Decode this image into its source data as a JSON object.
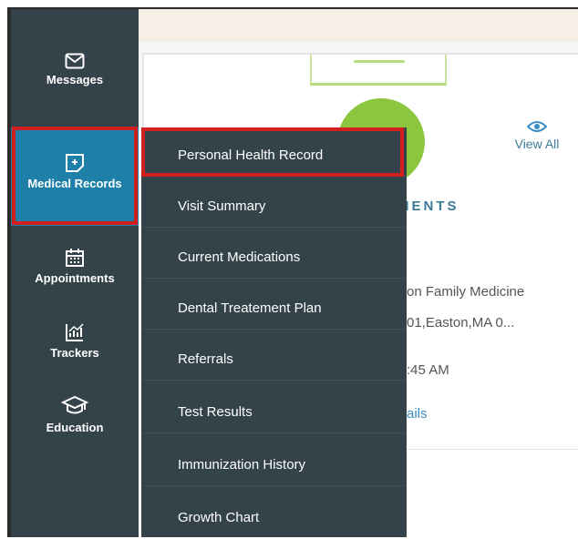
{
  "sidebar": {
    "items": [
      {
        "label": "Messages",
        "icon": "envelope-icon"
      },
      {
        "label": "Medical Records",
        "icon": "document-plus-icon",
        "active": true
      },
      {
        "label": "Appointments",
        "icon": "calendar-icon"
      },
      {
        "label": "Trackers",
        "icon": "chart-icon"
      },
      {
        "label": "Education",
        "icon": "graduation-cap-icon"
      }
    ]
  },
  "card": {
    "view_all_label": "View All",
    "section_heading_fragment": "MENTS"
  },
  "content_fragments": {
    "line1": "on Family Medicine",
    "line2": "01,Easton,MA 0...",
    "line3": ":45 AM",
    "line4": "ails"
  },
  "dropdown": {
    "items": [
      "Personal Health Record",
      "Visit Summary",
      "Current Medications",
      "Dental Treatement Plan",
      "Referrals",
      "Test Results",
      "Immunization History",
      "Growth Chart"
    ],
    "highlighted_index": 0
  },
  "colors": {
    "sidebar_bg": "#34424a",
    "active_bg": "#1e7fa8",
    "highlight_border": "#d21f1f",
    "accent_green": "#8cc63e",
    "link_blue": "#3b7a98"
  }
}
